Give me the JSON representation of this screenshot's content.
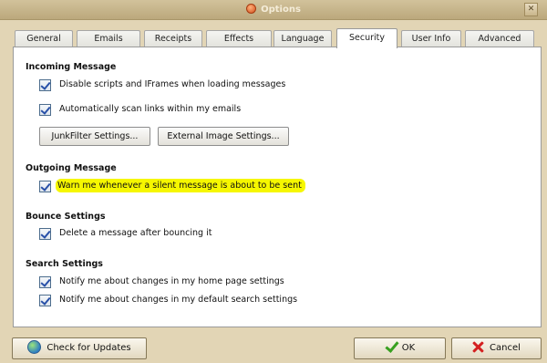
{
  "window": {
    "title": "Options",
    "close_icon": "close-icon",
    "app_icon": "envelope-icon"
  },
  "tabs": [
    {
      "label": "General"
    },
    {
      "label": "Emails"
    },
    {
      "label": "Receipts"
    },
    {
      "label": "Effects"
    },
    {
      "label": "Language"
    },
    {
      "label": "Security",
      "active": true
    },
    {
      "label": "User Info"
    },
    {
      "label": "Advanced"
    }
  ],
  "incoming": {
    "title": "Incoming Message",
    "disable_scripts": {
      "label": "Disable scripts and IFrames when loading messages",
      "checked": true
    },
    "scan_links": {
      "label": "Automatically scan links within my emails",
      "checked": true
    },
    "junkfilter_button": "JunkFilter Settings...",
    "external_image_button": "External Image Settings..."
  },
  "outgoing": {
    "title": "Outgoing Message",
    "warn_silent": {
      "label": "Warn me whenever a silent message is about to be sent",
      "checked": true
    },
    "highlight_color": "#f6f700"
  },
  "bounce": {
    "title": "Bounce Settings",
    "delete_after_bounce": {
      "label": "Delete a message after bouncing it",
      "checked": true
    }
  },
  "search": {
    "title": "Search Settings",
    "notify_home": {
      "label": "Notify me about changes in my home page settings",
      "checked": true
    },
    "notify_search": {
      "label": "Notify me about changes in my default search settings",
      "checked": true
    }
  },
  "footer": {
    "check_updates": "Check for Updates",
    "ok": "OK",
    "cancel": "Cancel",
    "updates_icon": "globe-icon",
    "ok_icon": "checkmark-icon",
    "cancel_icon": "cross-icon"
  }
}
